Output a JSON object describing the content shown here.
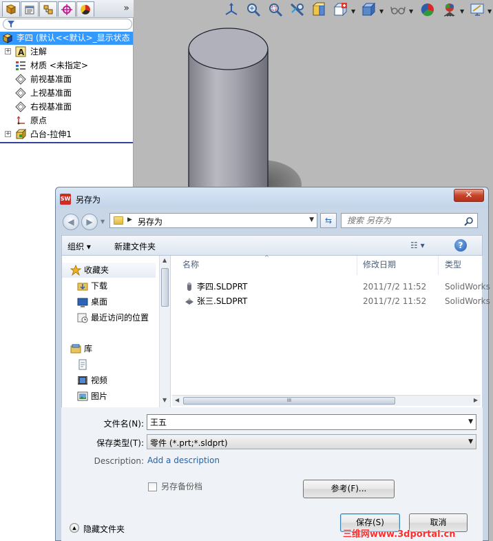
{
  "feature_tree": {
    "root_label": "李四 (默认<<默认>_显示状态",
    "items": [
      {
        "label": "注解",
        "icon": "annotation-icon",
        "expandable": true
      },
      {
        "label": "材质 <未指定>",
        "icon": "material-icon",
        "expandable": false
      },
      {
        "label": "前视基准面",
        "icon": "plane-icon",
        "expandable": false
      },
      {
        "label": "上视基准面",
        "icon": "plane-icon",
        "expandable": false
      },
      {
        "label": "右视基准面",
        "icon": "plane-icon",
        "expandable": false
      },
      {
        "label": "原点",
        "icon": "origin-icon",
        "expandable": false
      },
      {
        "label": "凸台-拉伸1",
        "icon": "extrude-icon",
        "expandable": true
      }
    ],
    "tabs_more": "»"
  },
  "dialog": {
    "title": "另存为",
    "close": "✕",
    "address": "另存为",
    "search_placeholder": "搜索 另存为",
    "organize": "组织 ▾",
    "new_folder": "新建文件夹",
    "view_menu": "☷ ▾",
    "help": "?",
    "nav": {
      "favorites": "收藏夹",
      "items": [
        "下载",
        "桌面",
        "最近访问的位置"
      ],
      "library": "库",
      "library_items": [
        "",
        "视频",
        "图片"
      ]
    },
    "columns": {
      "name": "名称",
      "date": "修改日期",
      "type": "类型"
    },
    "files": [
      {
        "name": "李四.SLDPRT",
        "date": "2011/7/2 11:52",
        "type": "SolidWorks"
      },
      {
        "name": "张三.SLDPRT",
        "date": "2011/7/2 11:52",
        "type": "SolidWorks"
      }
    ],
    "scroll_grip": "III",
    "filename_label": "文件名(N):",
    "filename_value": "王五",
    "filetype_label": "保存类型(T):",
    "filetype_value": "零件 (*.prt;*.sldprt)",
    "description_label": "Description:",
    "description_link": "Add a description",
    "backup_label": "另存备份档",
    "browse_button": "参考(F)...",
    "save_button": "保存(S)",
    "cancel_button": "取消",
    "hide_folders": "隐藏文件夹"
  },
  "watermark": "三维网www.3dportal.cn"
}
